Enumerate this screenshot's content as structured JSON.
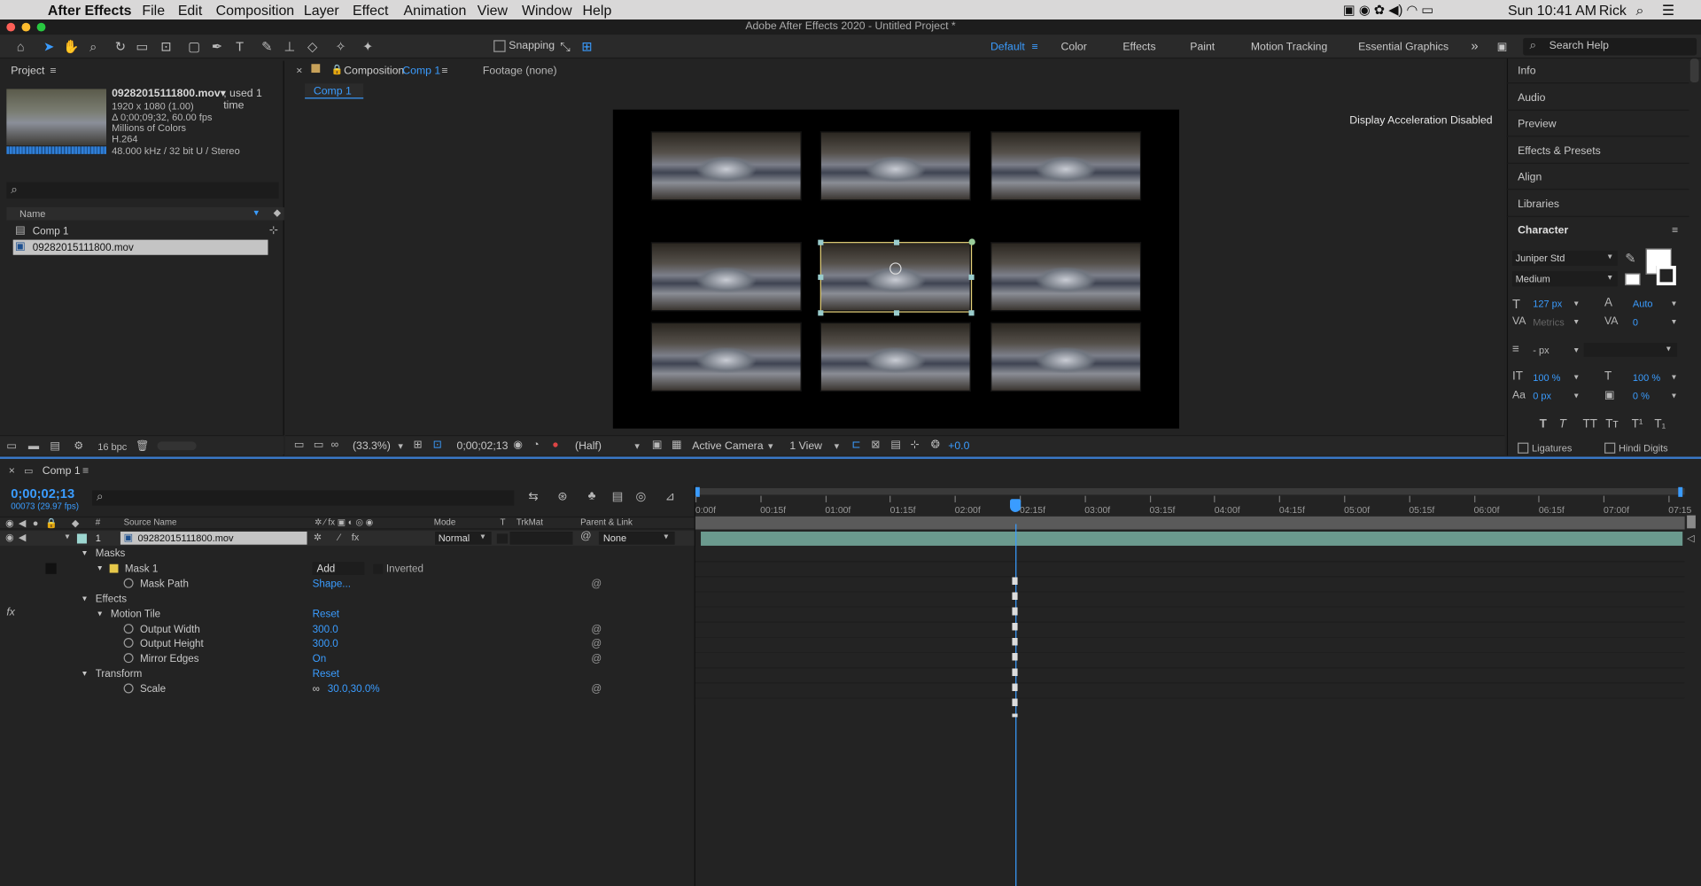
{
  "menubar": {
    "apple": "",
    "app": "After Effects",
    "items": [
      "File",
      "Edit",
      "Composition",
      "Layer",
      "Effect",
      "Animation",
      "View",
      "Window",
      "Help"
    ],
    "clock": "Sun 10:41 AM",
    "user": "Rick"
  },
  "window": {
    "title": "Adobe After Effects 2020 - Untitled Project *"
  },
  "toolbar": {
    "snapping": "Snapping",
    "workspaces": [
      "Default",
      "Color",
      "Effects",
      "Paint",
      "Motion Tracking",
      "Essential Graphics"
    ],
    "search_placeholder": "Search Help"
  },
  "project": {
    "title": "Project",
    "file_name": "09282015111800.mov▾",
    "used": ", used 1 time",
    "meta": [
      "1920 x 1080 (1.00)",
      "Δ 0;00;09;32, 60.00 fps",
      "Millions of Colors",
      "H.264",
      "48.000 kHz / 32 bit U / Stereo"
    ],
    "col_name": "Name",
    "items": [
      "Comp 1",
      "09282015111800.mov"
    ],
    "bpc": "16 bpc"
  },
  "comp_panel": {
    "tab_close": "×",
    "tab_prefix": "Composition",
    "tab_name": "Comp 1",
    "footage": "Footage (none)",
    "subtab": "Comp 1",
    "display_msg": "Display Acceleration Disabled",
    "zoom": "(33.3%)",
    "timecode": "0;00;02;13",
    "resolution": "(Half)",
    "camera": "Active Camera",
    "views": "1 View",
    "exposure": "+0.0"
  },
  "right_panels": {
    "items": [
      "Info",
      "Audio",
      "Preview",
      "Effects & Presets",
      "Align",
      "Libraries"
    ],
    "character": {
      "title": "Character",
      "font": "Juniper Std",
      "style": "Medium",
      "size": "127 px",
      "leading": "Auto",
      "kerning": "Metrics",
      "tracking": "0",
      "stroke": "- px",
      "vscale": "100 %",
      "hscale": "100 %",
      "baseline": "0 px",
      "tsume": "0 %",
      "ligatures": "Ligatures",
      "hindi": "Hindi Digits"
    }
  },
  "timeline": {
    "tab": "Comp 1",
    "timecode": "0;00;02;13",
    "frames": "00073 (29.97 fps)",
    "cols": {
      "num": "#",
      "source": "Source Name",
      "mode": "Mode",
      "t": "T",
      "trkmat": "TrkMat",
      "parent": "Parent & Link"
    },
    "layer": {
      "num": "1",
      "name": "09282015111800.mov",
      "mode": "Normal",
      "parent": "None"
    },
    "props": [
      {
        "label": "Masks",
        "indent": 1
      },
      {
        "label": "Mask 1",
        "indent": 2,
        "value": "Add",
        "extra": "Inverted"
      },
      {
        "label": "Mask Path",
        "indent": 3,
        "value": "Shape..."
      },
      {
        "label": "Effects",
        "indent": 1
      },
      {
        "label": "Motion Tile",
        "indent": 2,
        "value": "Reset"
      },
      {
        "label": "Output Width",
        "indent": 3,
        "value": "300.0"
      },
      {
        "label": "Output Height",
        "indent": 3,
        "value": "300.0"
      },
      {
        "label": "Mirror Edges",
        "indent": 3,
        "value": "On"
      },
      {
        "label": "Transform",
        "indent": 1,
        "value": "Reset"
      },
      {
        "label": "Scale",
        "indent": 3,
        "value": "30.0,30.0%"
      }
    ],
    "ruler": [
      "0:00f",
      "00:15f",
      "01:00f",
      "01:15f",
      "02:00f",
      "02:15f",
      "03:00f",
      "03:15f",
      "04:00f",
      "04:15f",
      "05:00f",
      "05:15f",
      "06:00f",
      "06:15f",
      "07:00f",
      "07:15"
    ]
  }
}
